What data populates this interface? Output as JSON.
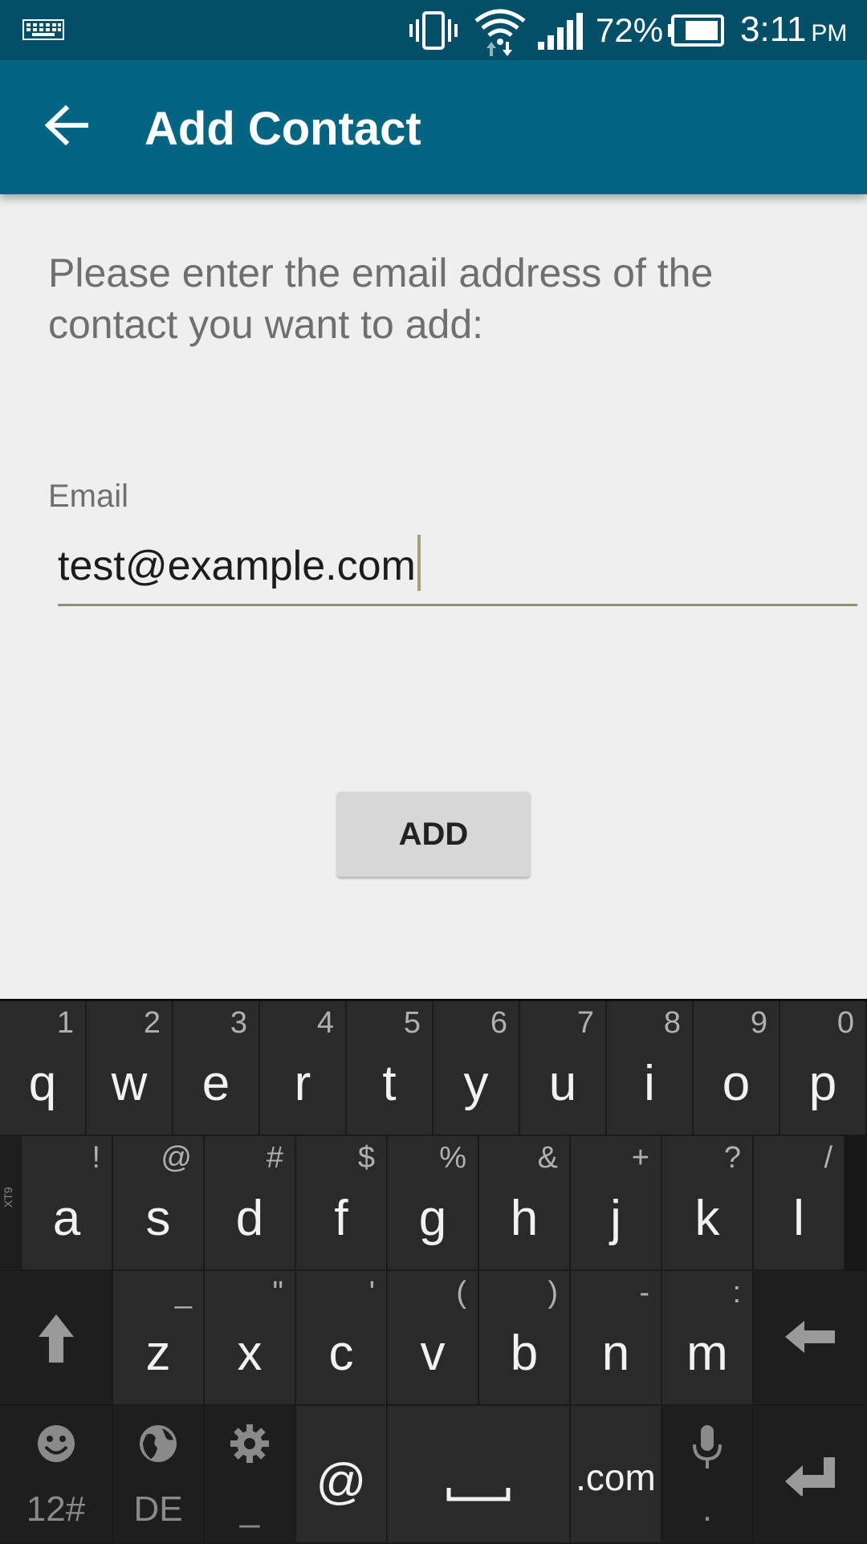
{
  "status_bar": {
    "battery_percent": "72%",
    "time": "3:11",
    "ampm": "PM",
    "icons": [
      "keyboard-icon",
      "vibrate-icon",
      "wifi-icon",
      "signal-icon",
      "battery-icon"
    ]
  },
  "app_bar": {
    "title": "Add Contact",
    "back_icon": "arrow-left-icon"
  },
  "form": {
    "prompt": "Please enter the email address of the contact you want to add:",
    "email_label": "Email",
    "email_value": "test@example.com",
    "add_label": "ADD"
  },
  "keyboard": {
    "row1": [
      {
        "key": "q",
        "hint": "1"
      },
      {
        "key": "w",
        "hint": "2"
      },
      {
        "key": "e",
        "hint": "3"
      },
      {
        "key": "r",
        "hint": "4"
      },
      {
        "key": "t",
        "hint": "5"
      },
      {
        "key": "y",
        "hint": "6"
      },
      {
        "key": "u",
        "hint": "7"
      },
      {
        "key": "i",
        "hint": "8"
      },
      {
        "key": "o",
        "hint": "9"
      },
      {
        "key": "p",
        "hint": "0"
      }
    ],
    "row2": [
      {
        "key": "a",
        "hint": "!"
      },
      {
        "key": "s",
        "hint": "@"
      },
      {
        "key": "d",
        "hint": "#"
      },
      {
        "key": "f",
        "hint": "$"
      },
      {
        "key": "g",
        "hint": "%"
      },
      {
        "key": "h",
        "hint": "&"
      },
      {
        "key": "j",
        "hint": "+"
      },
      {
        "key": "k",
        "hint": "?"
      },
      {
        "key": "l",
        "hint": "/"
      }
    ],
    "row3": [
      {
        "key": "z",
        "hint": "_"
      },
      {
        "key": "x",
        "hint": "\""
      },
      {
        "key": "c",
        "hint": "'"
      },
      {
        "key": "v",
        "hint": "("
      },
      {
        "key": "b",
        "hint": ")"
      },
      {
        "key": "n",
        "hint": "-"
      },
      {
        "key": "m",
        "hint": ":"
      }
    ],
    "bottom": {
      "symbols_label": "12#",
      "language_label": "DE",
      "settings_sub": "_",
      "at_label": "@",
      "com_label": ".com",
      "mic_sub": "."
    },
    "side_tab_label": "XT9"
  }
}
